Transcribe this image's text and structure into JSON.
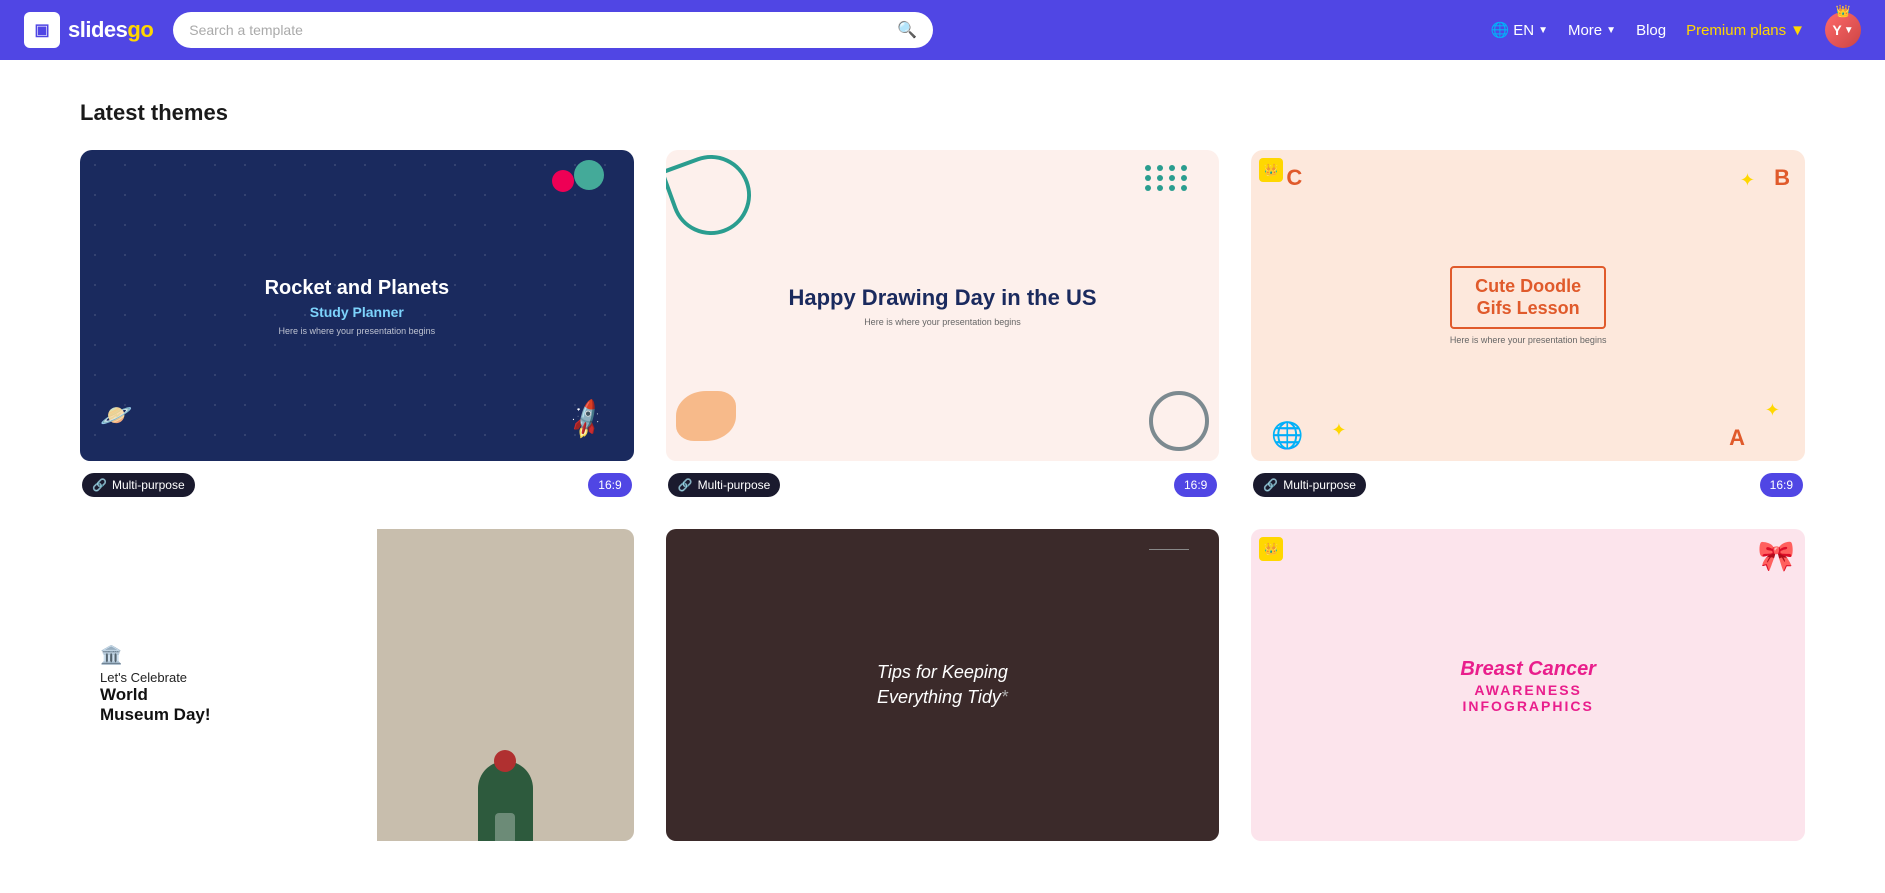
{
  "header": {
    "logo_text": "slidesgo",
    "search_placeholder": "Search a template",
    "nav_language": "EN",
    "nav_more": "More",
    "nav_blog": "Blog",
    "nav_premium": "Premium plans",
    "avatar_initial": "Y"
  },
  "main": {
    "section_title": "Latest themes",
    "cards_row1": [
      {
        "id": "card-1",
        "title": "Rocket and Planets",
        "subtitle": "Study Planner",
        "tagline": "Here is where your presentation begins",
        "tag": "Multi-purpose",
        "ratio": "16:9",
        "premium": false
      },
      {
        "id": "card-2",
        "title": "Happy Drawing Day in the US",
        "tagline": "Here is where your presentation begins",
        "tag": "Multi-purpose",
        "ratio": "16:9",
        "premium": false
      },
      {
        "id": "card-3",
        "title": "Cute Doodle Gifs Lesson",
        "tagline": "Here is where your presentation begins",
        "tag": "Multi-purpose",
        "ratio": "16:9",
        "premium": true
      }
    ],
    "cards_row2": [
      {
        "id": "card-4",
        "title": "Let's Celebrate World Museum Day!",
        "premium": false
      },
      {
        "id": "card-5",
        "title": "Tips for Keeping Everything Tidy*",
        "premium": false
      },
      {
        "id": "card-6",
        "title_line1": "Breast Cancer",
        "title_line2": "AWARENESS INFOGRAPHICS",
        "premium": true
      }
    ],
    "multipurpose_label": "Multi-purpose",
    "ratio_label": "16:9"
  }
}
